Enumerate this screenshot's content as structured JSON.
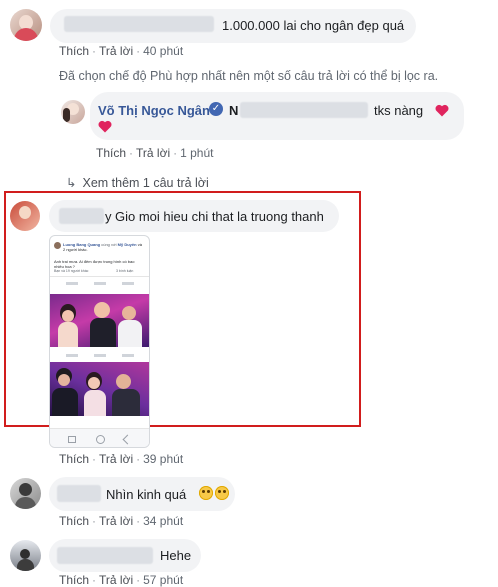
{
  "colors": {
    "bubble_bg": "#f2f3f5",
    "link": "#385898",
    "meta": "#606770",
    "highlight_box": "#d11d1d",
    "verified": "#4267b2",
    "heart": "#e0245e"
  },
  "comment1": {
    "text": "1.000.000 lai cho ngân đẹp quá",
    "like": "Thích",
    "reply": "Trả lời",
    "time": "40 phút"
  },
  "filter_notice": "Đã chọn chế độ Phù hợp nhất nên một số câu trả lời có thể bị lọc ra.",
  "reply1": {
    "author": "Võ Thị Ngọc Ngân",
    "author_initial": "N",
    "text": "tks nàng",
    "like": "Thích",
    "reply": "Trả lời",
    "time": "1 phút",
    "icons": [
      "verified-badge-icon",
      "heart-icon"
    ]
  },
  "see_more": "Xem thêm 1 câu trả lời",
  "comment2": {
    "author_partial": "y",
    "text": "Gio moi hieu chi that la truong thanh",
    "like": "Thích",
    "reply": "Trả lời",
    "time": "39 phút",
    "embedded_post": {
      "poster": "Luong Bang Quang",
      "poster_meta": "cùng với",
      "tagged": "Mỹ Duyên",
      "others": "và 2 người khác.",
      "caption": "Anh trai mưa. Ai đêm được trung hình có bao nhiêu hoa ?",
      "reactions": "Bạn và 19 người khác",
      "comments": "3 bình luận"
    }
  },
  "comment3": {
    "text": "Nhìn kinh quá",
    "like": "Thích",
    "reply": "Trả lời",
    "time": "34 phút",
    "icons": [
      "grimace-emoji-icon",
      "grimace-emoji-icon"
    ]
  },
  "comment4": {
    "text": "Hehe",
    "like": "Thích",
    "reply": "Trả lời",
    "time": "57 phút"
  }
}
